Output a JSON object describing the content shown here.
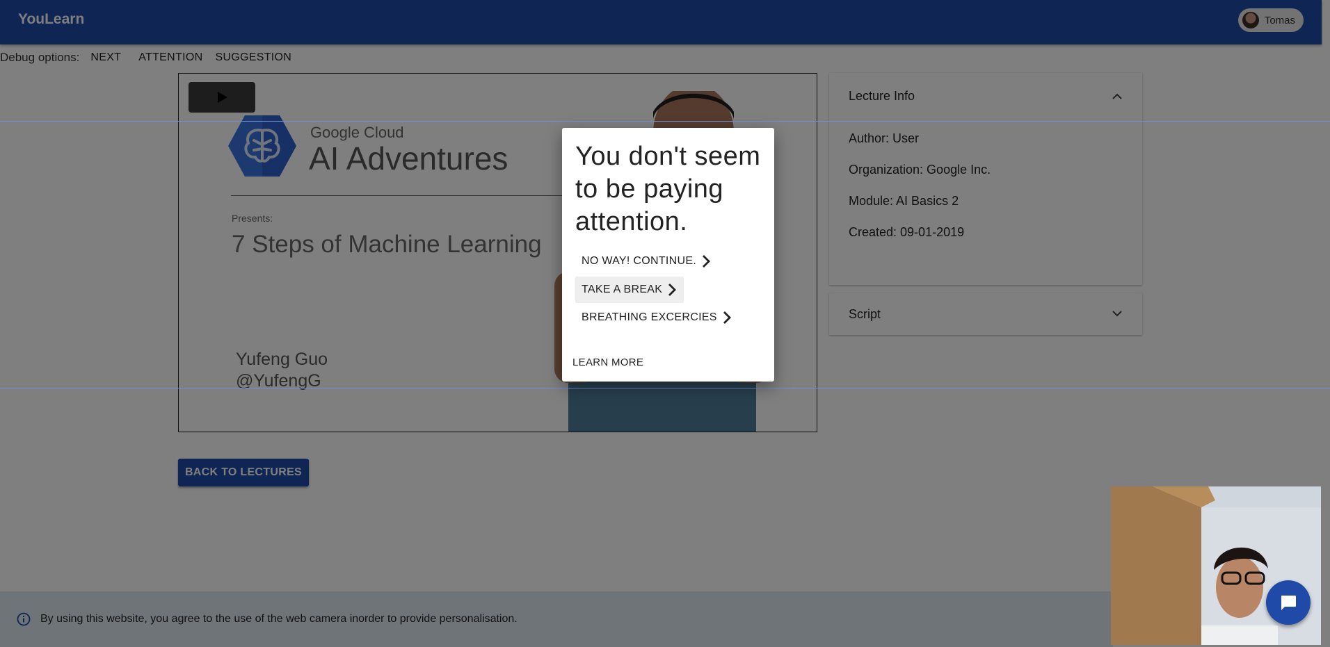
{
  "app": {
    "title": "YouLearn"
  },
  "user": {
    "name": "Tomas"
  },
  "debug": {
    "label": "Debug options:",
    "buttons": [
      "NEXT",
      "ATTENTION",
      "SUGGESTION"
    ]
  },
  "video": {
    "slide": {
      "brand_small": "Google Cloud",
      "brand_large": "AI Adventures",
      "presents": "Presents:",
      "title": "7 Steps of Machine Learning",
      "speaker_name": "Yufeng Guo",
      "speaker_handle": "@YufengG"
    }
  },
  "modal": {
    "heading": "You don't seem to be paying attention.",
    "options": [
      "NO WAY! CONTINUE.",
      "TAKE A BREAK",
      "BREATHING EXCERCIES"
    ],
    "learn_more": "LEARN MORE"
  },
  "lecture_info": {
    "title": "Lecture Info",
    "author": "Author: User",
    "organization": "Organization: Google Inc.",
    "module": "Module: AI Basics 2",
    "created": "Created: 09-01-2019"
  },
  "script_panel": {
    "title": "Script"
  },
  "back_button": "BACK TO LECTURES",
  "cookie_notice": "By using this website, you agree to the use of the web camera inorder to provide personalisation.",
  "colors": {
    "primary": "#1f4aa8",
    "overlay": "rgba(0,0,0,0.5)"
  }
}
